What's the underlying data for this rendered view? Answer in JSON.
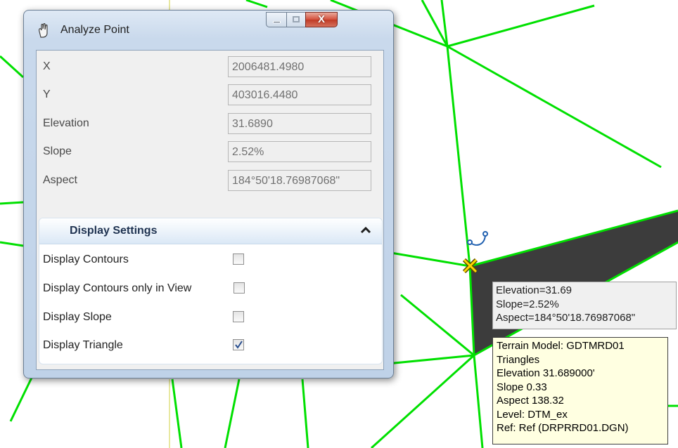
{
  "window": {
    "title": "Analyze Point",
    "close_glyph": "X",
    "icon": "hand-pointer-icon"
  },
  "properties": [
    {
      "label": "X",
      "value": "2006481.4980"
    },
    {
      "label": "Y",
      "value": "403016.4480"
    },
    {
      "label": "Elevation",
      "value": "31.6890"
    },
    {
      "label": "Slope",
      "value": "2.52%"
    },
    {
      "label": "Aspect",
      "value": "184°50'18.76987068\""
    }
  ],
  "display_settings": {
    "title": "Display Settings",
    "options": [
      {
        "label": "Display Contours",
        "checked": false
      },
      {
        "label": "Display Contours only in View",
        "checked": false
      },
      {
        "label": "Display Slope",
        "checked": false
      },
      {
        "label": "Display Triangle",
        "checked": true
      }
    ]
  },
  "tooltip_point": {
    "lines": [
      "Elevation=31.69",
      "Slope=2.52%",
      "Aspect=184°50'18.76987068\""
    ]
  },
  "tooltip_terrain": {
    "lines": [
      "Terrain Model: GDTMRD01",
      "Triangles",
      "Elevation 31.689000'",
      "Slope 0.33",
      "Aspect 138.32",
      "Level: DTM_ex",
      "Ref: Ref (DRPRRD01.DGN)"
    ]
  },
  "colors": {
    "triangle_lines": "#00e000",
    "selected_triangle": "#3c3c3c",
    "cursor_marker": "#e8c800",
    "tooltip_bg": "#ffffe1"
  }
}
